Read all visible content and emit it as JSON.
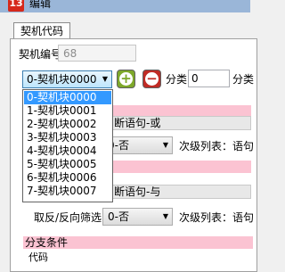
{
  "window": {
    "icon_text": "13",
    "title": "编辑"
  },
  "tab": {
    "label": "契机代码"
  },
  "id_field": {
    "label": "契机编号",
    "value": "68"
  },
  "module_select": {
    "selected": "0-契机块0000",
    "options": [
      "0-契机块0000",
      "1-契机块0001",
      "2-契机块0002",
      "3-契机块0003",
      "4-契机块0004",
      "5-契机块0005",
      "6-契机块0006",
      "7-契机块0007"
    ]
  },
  "add_button": {
    "glyph": "+"
  },
  "remove_button": {
    "glyph": "−"
  },
  "category": {
    "label": "分类",
    "value": "0",
    "label_2": "分类"
  },
  "group1": {
    "header": "断语句-或",
    "filter_value": "0-否",
    "sublist_label": "次级列表：语句"
  },
  "group2": {
    "header": "断语句-与",
    "filter_label": "取反/反向筛选",
    "filter_value": "0-否",
    "sublist_label": "次级列表：语句"
  },
  "branch": {
    "label": "分支条件"
  },
  "bottom_fragment": "代码",
  "colors": {
    "accent": "#3399ff",
    "add": "#7ea82a",
    "remove": "#bf2b25",
    "highlight": "#fbc3d2"
  },
  "icons": {
    "add": "plus-circle-icon",
    "remove": "minus-circle-icon",
    "dropdown": "chevron-down-icon"
  }
}
